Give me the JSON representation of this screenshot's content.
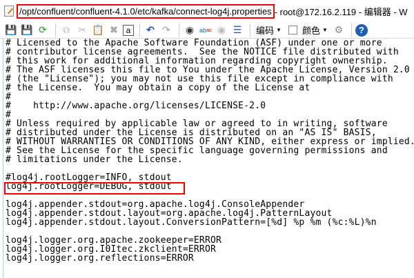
{
  "window": {
    "title_path": "/opt/confluent/confluent-4.1.0/etc/kafka/connect-log4j.properties",
    "title_rest": " - root@172.16.2.119 - 编辑器 - W"
  },
  "toolbar": {
    "encoding_label": "编码",
    "color_label": "颜色",
    "accent": "#1e5fb4",
    "help": "?"
  },
  "editor": {
    "lines": [
      "# Licensed to the Apache Software Foundation (ASF) under one or more",
      "# contributor license agreements.  See the NOTICE file distributed with",
      "# this work for additional information regarding copyright ownership.",
      "# The ASF licenses this file to You under the Apache License, Version 2.0",
      "# (the \"License\"); you may not use this file except in compliance with",
      "# the License.  You may obtain a copy of the License at",
      "#",
      "#    http://www.apache.org/licenses/LICENSE-2.0",
      "#",
      "# Unless required by applicable law or agreed to in writing, software",
      "# distributed under the License is distributed on an \"AS IS\" BASIS,",
      "# WITHOUT WARRANTIES OR CONDITIONS OF ANY KIND, either express or implied.",
      "# See the License for the specific language governing permissions and",
      "# limitations under the License.",
      "",
      "#log4j.rootLogger=INFO, stdout",
      "log4j.rootLogger=DEBUG, stdout",
      "",
      "log4j.appender.stdout=org.apache.log4j.ConsoleAppender",
      "log4j.appender.stdout.layout=org.apache.log4j.PatternLayout",
      "log4j.appender.stdout.layout.ConversionPattern=[%d] %p %m (%c:%L)%n",
      "",
      "log4j.logger.org.apache.zookeeper=ERROR",
      "log4j.logger.org.I0Itec.zkclient=ERROR",
      "log4j.logger.org.reflections=ERROR"
    ]
  }
}
